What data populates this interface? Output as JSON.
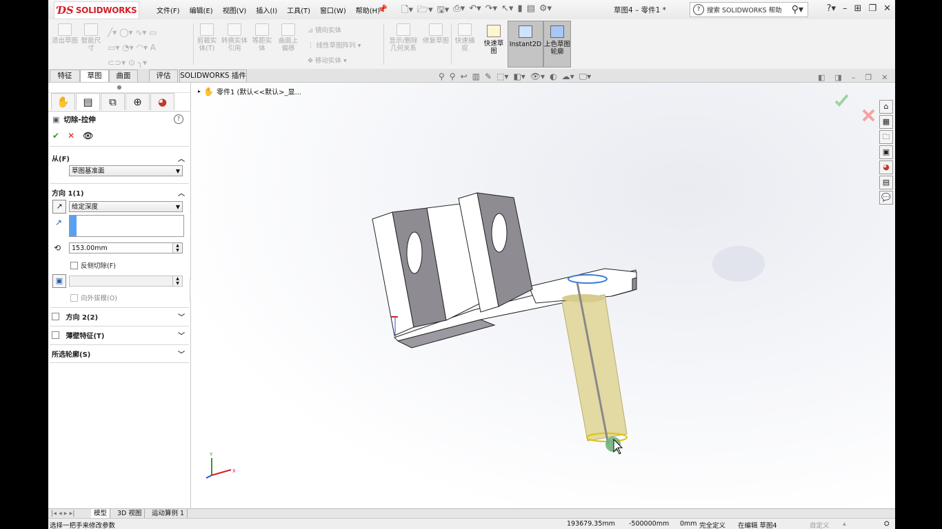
{
  "titlebar": {
    "logo_text": "SOLIDWORKS",
    "menus": [
      "文件(F)",
      "编辑(E)",
      "视图(V)",
      "插入(I)",
      "工具(T)",
      "窗口(W)",
      "帮助(H)"
    ],
    "doc_title": "草图4 – 零件1 *",
    "search_placeholder": "搜索 SOLIDWORKS 帮助"
  },
  "cmd": {
    "exit_sketch": "退出草图",
    "smart_dim": "智能尺寸",
    "trim": "剪裁实体(T)",
    "convert": "转换实体引用",
    "offset": "等距实体",
    "surface_offset": "曲面上偏移",
    "mirror": "镜向实体",
    "linear_pattern": "线性草图阵列",
    "move": "移动实体",
    "relations": "显示/删除几何关系",
    "repair": "修复草图",
    "quick_snaps": "快速捕捉",
    "rapid_sketch": "快速草图",
    "instant2d": "Instant2D",
    "shaded_contours": "上色草图轮廓"
  },
  "tabs": [
    "特征",
    "草图",
    "曲面",
    "评估",
    "SOLIDWORKS 插件"
  ],
  "active_tab": "草图",
  "panel": {
    "title": "切除-拉伸",
    "from_label": "从(F)",
    "from_value": "草图基准面",
    "dir1_label": "方向 1(1)",
    "dir1_type": "给定深度",
    "depth": "153.00mm",
    "flip_cut": "反侧切除(F)",
    "draft_outward": "向外拔模(O)",
    "dir2_label": "方向 2(2)",
    "thin_label": "薄壁特征(T)",
    "contours_label": "所选轮廓(S)"
  },
  "tree": {
    "root_label": "零件1 (默认<<默认>_显..."
  },
  "bottom_tabs": [
    "模型",
    "3D 视图",
    "运动算例 1"
  ],
  "status": {
    "message": "选择一把手来修改参数",
    "x": "193679.35mm",
    "y": "-500000mm",
    "z": "0mm",
    "state": "完全定义",
    "editing": "在编辑 草图4",
    "units": "自定义"
  },
  "colors": {
    "accent_red": "#d21f26",
    "cylinder": "#e3d9a3",
    "part_face_light": "#ffffff",
    "part_face_dark": "#8e8b93"
  }
}
